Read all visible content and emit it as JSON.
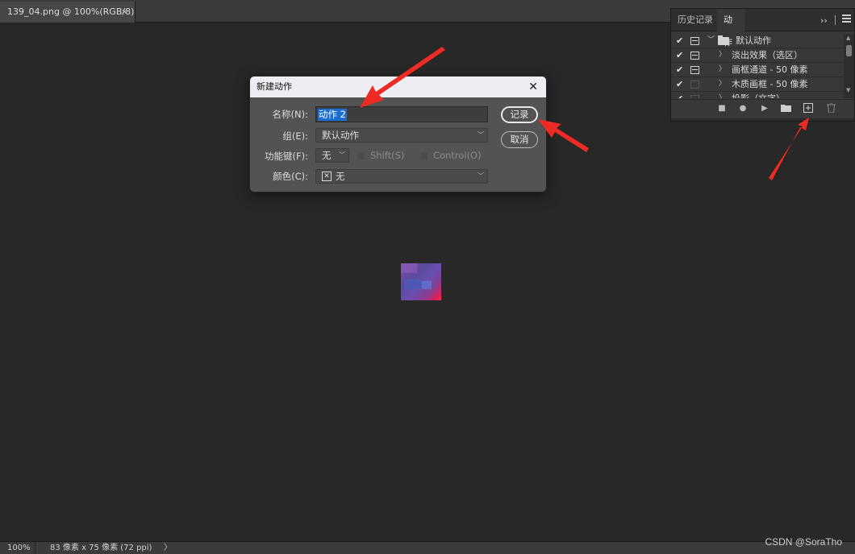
{
  "document_tab": {
    "title": "139_04.png @ 100%(RGB/8)",
    "close_glyph": "×"
  },
  "status_bar": {
    "zoom": "100%",
    "doc_info": "83 像素 x 75 像素 (72 ppi)",
    "arrow_glyph": "〉"
  },
  "watermark": "CSDN @SoraTho",
  "actions_panel": {
    "tabs": [
      "历史记录",
      "动作"
    ],
    "active_tab": "动作",
    "expand_glyph": "››",
    "rows": [
      {
        "label": "默认动作",
        "checked": true,
        "type": "set"
      },
      {
        "label": "淡出效果（选区）",
        "checked": true,
        "type": "action"
      },
      {
        "label": "画框通道 - 50 像素",
        "checked": true,
        "type": "action"
      },
      {
        "label": "木质画框 - 50 像素",
        "checked": true,
        "type": "action"
      },
      {
        "label": "投影（文字）",
        "checked": true,
        "type": "action"
      }
    ],
    "footer_icons": [
      "stop-icon",
      "record-icon",
      "play-icon",
      "new-set-icon",
      "new-action-icon",
      "trash-icon"
    ]
  },
  "dialog": {
    "title": "新建动作",
    "close_glyph": "✕",
    "name_label": "名称(N):",
    "name_value": "动作 2",
    "set_label": "组(E):",
    "set_value": "默认动作",
    "fkey_label": "功能键(F):",
    "fkey_value": "无",
    "shift_label": "Shift(S)",
    "control_label": "Control(O)",
    "color_label": "颜色(C):",
    "color_value": "无",
    "record_button": "记录",
    "cancel_button": "取消"
  },
  "annotation_color": "#ee2a24"
}
